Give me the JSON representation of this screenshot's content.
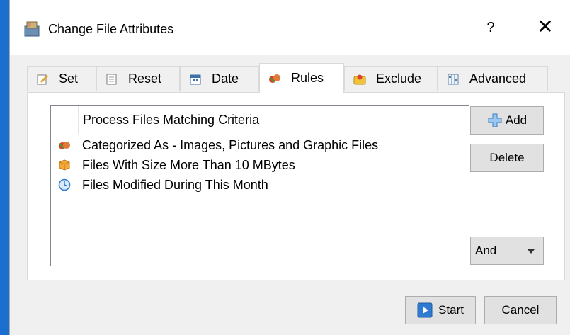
{
  "window": {
    "title": "Change File Attributes",
    "help_label": "?",
    "close_label": "✕"
  },
  "tabs": [
    {
      "label": "Set",
      "icon": "set-icon"
    },
    {
      "label": "Reset",
      "icon": "reset-icon"
    },
    {
      "label": "Date",
      "icon": "date-icon"
    },
    {
      "label": "Rules",
      "icon": "rules-icon",
      "active": true
    },
    {
      "label": "Exclude",
      "icon": "exclude-icon"
    },
    {
      "label": "Advanced",
      "icon": "advanced-icon"
    }
  ],
  "rules": {
    "header": "Process Files Matching Criteria",
    "items": [
      {
        "label": "Categorized As - Images, Pictures and Graphic Files",
        "icon": "category-icon"
      },
      {
        "label": "Files With Size More Than 10 MBytes",
        "icon": "size-icon"
      },
      {
        "label": "Files Modified During This Month",
        "icon": "clock-icon"
      }
    ],
    "add_label": "Add",
    "delete_label": "Delete",
    "combinator": "And"
  },
  "footer": {
    "start_label": "Start",
    "cancel_label": "Cancel"
  },
  "colors": {
    "desktop": "#1b6fcf",
    "dialog_bg": "#f0f0f0",
    "button_bg": "#e1e1e1"
  }
}
